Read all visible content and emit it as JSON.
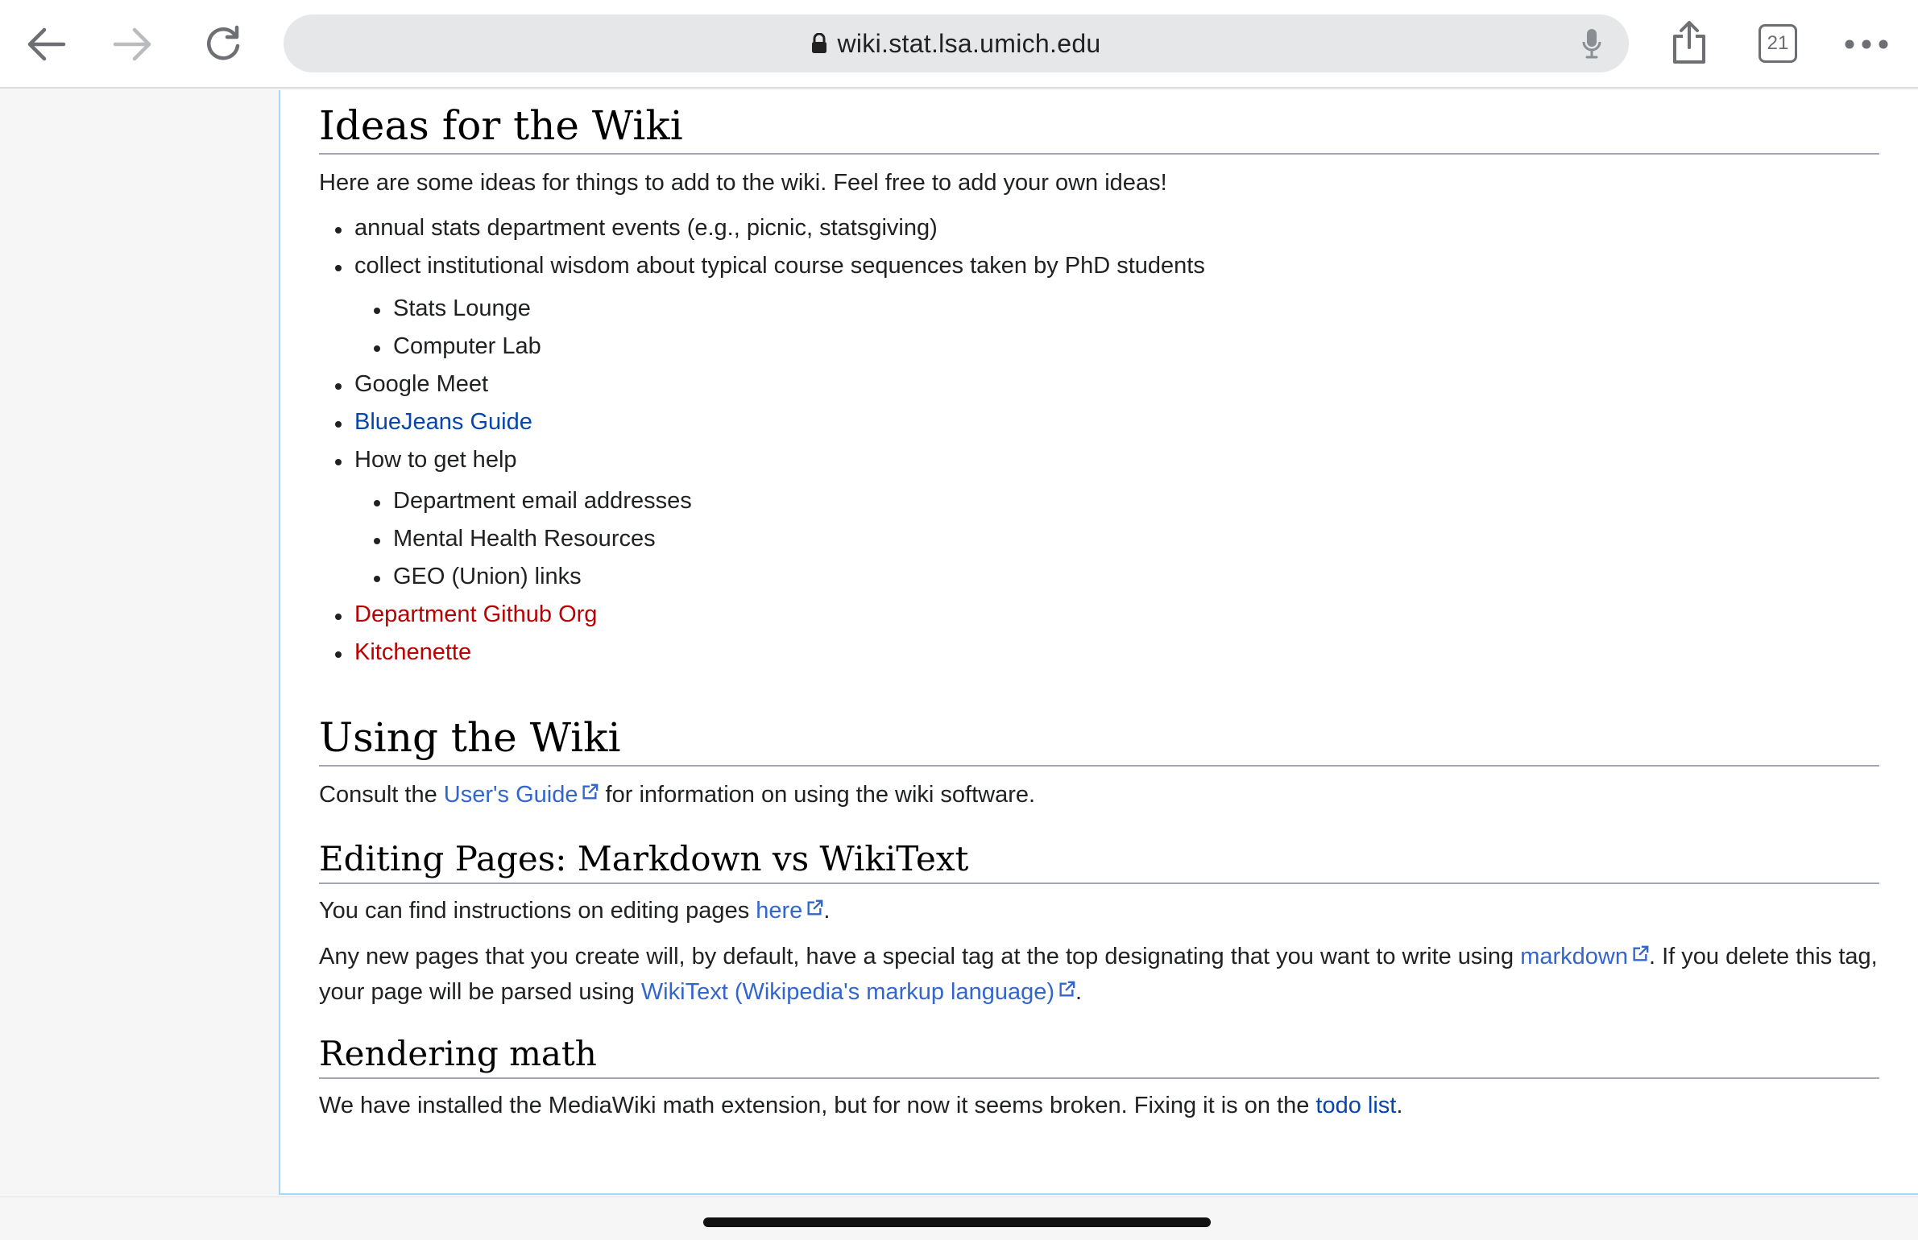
{
  "browser": {
    "url": "wiki.stat.lsa.umich.edu",
    "tab_count": "21",
    "icons": [
      "back-arrow-icon",
      "forward-arrow-icon",
      "reload-icon",
      "lock-icon",
      "microphone-icon",
      "share-icon",
      "tabs-icon",
      "more-icon"
    ]
  },
  "ideas": {
    "heading": "Ideas for the Wiki",
    "intro": "Here are some ideas for things to add to the wiki. Feel free to add your own ideas!",
    "items": [
      "annual stats department events (e.g., picnic, statsgiving)",
      "collect institutional wisdom about typical course sequences taken by PhD students",
      "Google Meet",
      "BlueJeans Guide",
      "How to get help",
      "Department Github Org",
      "Kitchenette"
    ],
    "sub_items_course": [
      "Stats Lounge",
      "Computer Lab"
    ],
    "sub_items_help": [
      "Department email addresses",
      "Mental Health Resources",
      "GEO (Union) links"
    ]
  },
  "using": {
    "heading": "Using the Wiki",
    "consult_pre": "Consult the",
    "users_guide_link": "User's Guide",
    "consult_post": "for information on using the wiki software."
  },
  "editing": {
    "heading": "Editing Pages: Markdown vs WikiText",
    "p1_pre": "You can find instructions on editing pages",
    "here_link": "here",
    "p1_post": ".",
    "p2_pre": "Any new pages that you create will, by default, have a special tag at the top designating that you want to write using",
    "markdown_link": "markdown",
    "p2_mid": ". If you delete this tag, your page will be parsed using",
    "wikitext_link": "WikiText (Wikipedia's markup language)",
    "p2_post": "."
  },
  "math": {
    "heading": "Rendering math",
    "text_pre": "We have installed the MediaWiki math extension, but for now it seems broken. Fixing it is on the",
    "todo_link": "todo list",
    "text_post": "."
  },
  "colors": {
    "link": "#3366cc",
    "link_internal": "#0645ad",
    "link_missing": "#ba0000",
    "panel_border": "#a7d7f9"
  }
}
